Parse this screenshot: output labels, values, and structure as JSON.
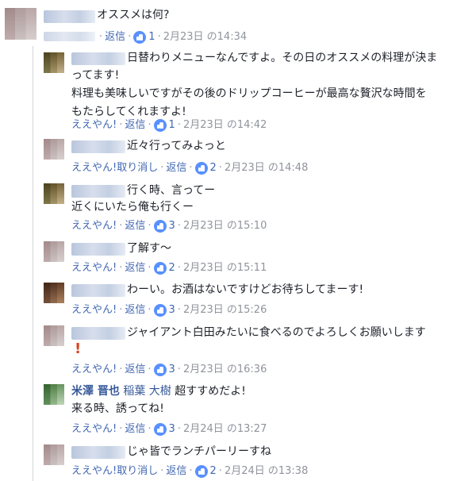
{
  "top_comment": {
    "text": "オススメは何?",
    "reply_label": "返信",
    "likes": "1",
    "time": "2月23日 の14:34"
  },
  "replies": [
    {
      "lines": [
        "日替わりメニューなんですよ。その日のオススメの料理が決ま",
        "ってます!",
        "料理も美味しいですがその後のドリップコーヒーが最高な贅沢な時間を",
        "もたらしてくれますよ!"
      ],
      "action": "ええやん!",
      "reply_label": "返信",
      "likes": "1",
      "time": "2月23日 の14:42"
    },
    {
      "lines": [
        "近々行ってみよっと"
      ],
      "action": "ええやん!取り消し",
      "reply_label": "返信",
      "likes": "2",
      "time": "2月23日 の14:48"
    },
    {
      "lines": [
        "行く時、言ってー",
        "近くにいたら俺も行くー"
      ],
      "action": "ええやん!",
      "reply_label": "返信",
      "likes": "3",
      "time": "2月23日 の15:10"
    },
    {
      "lines": [
        "了解す〜"
      ],
      "action": "ええやん!",
      "reply_label": "返信",
      "likes": "2",
      "time": "2月23日 の15:11"
    },
    {
      "lines": [
        "わーい。お酒はないですけどお待ちしてまーす!"
      ],
      "action": "ええやん!",
      "reply_label": "返信",
      "likes": "3",
      "time": "2月23日 の15:26"
    },
    {
      "lines": [
        "ジャイアント白田みたいに食べるのでよろしくお願いします"
      ],
      "emoji": "!",
      "action": "ええやん!",
      "reply_label": "返信",
      "likes": "3",
      "time": "2月23日 の16:36"
    },
    {
      "author": "米澤 晋也",
      "tagged": "稲葉 大樹",
      "lines": [
        "超すすめだよ!",
        "来る時、誘ってね!"
      ],
      "action": "ええやん!",
      "reply_label": "返信",
      "likes": "3",
      "time": "2月24日 の13:27"
    },
    {
      "lines": [
        "じゃ皆でランチパーリーすね"
      ],
      "action": "ええやん!取り消し",
      "reply_label": "返信",
      "likes": "2",
      "time": "2月24日 の13:38"
    }
  ]
}
